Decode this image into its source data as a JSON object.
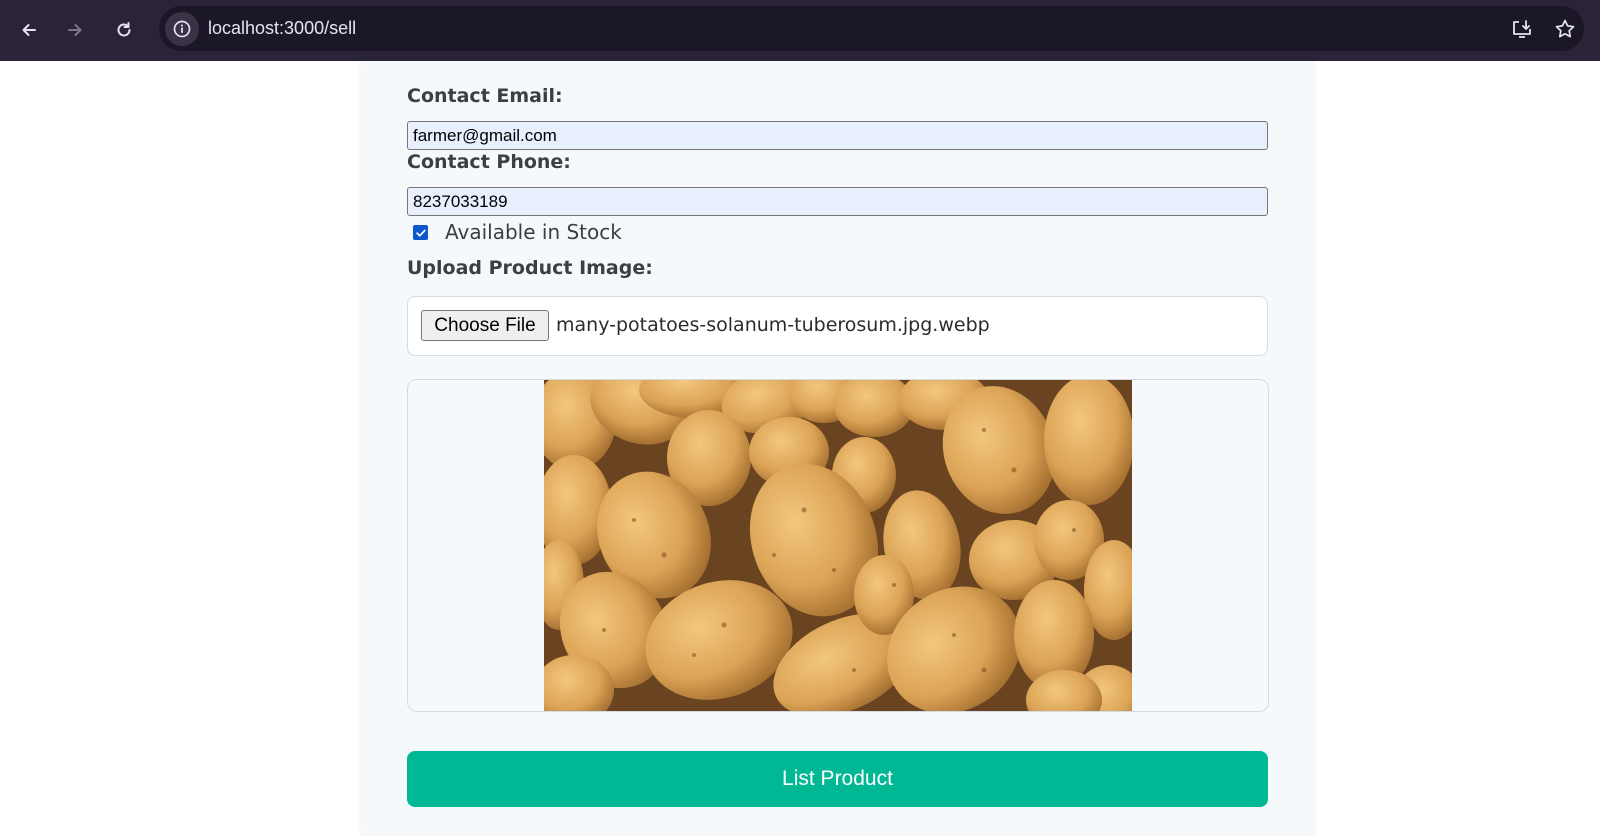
{
  "browser": {
    "url": "localhost:3000/sell",
    "icons": [
      "back-arrow-icon",
      "forward-arrow-icon",
      "reload-icon",
      "site-info-icon",
      "install-app-icon",
      "bookmark-star-icon"
    ]
  },
  "form": {
    "contact_email_label": "Contact Email:",
    "contact_email_value": "farmer@gmail.com",
    "contact_phone_label": "Contact Phone:",
    "contact_phone_value": "8237033189",
    "stock_label": "Available in Stock",
    "stock_checked": true,
    "upload_label": "Upload Product Image:",
    "choose_file_label": "Choose File",
    "file_name": "many-potatoes-solanum-tuberosum.jpg.webp",
    "preview_image": "potatoes-photo",
    "submit_label": "List Product"
  },
  "colors": {
    "chrome_bg": "#2b2438",
    "card_bg": "#f6f9fc",
    "input_bg": "#e8f0fe",
    "accent": "#00b894",
    "checkbox": "#0b57d0"
  }
}
